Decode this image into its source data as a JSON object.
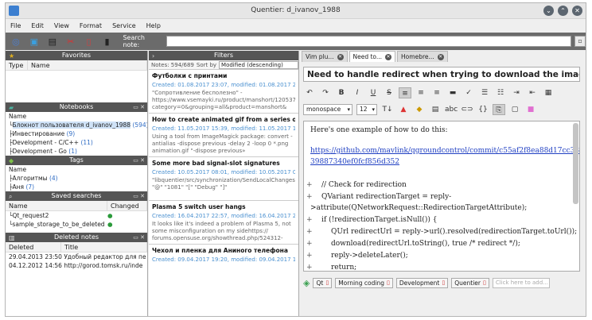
{
  "window": {
    "title": "Quentier: d_ivanov_1988"
  },
  "menu": [
    "File",
    "Edit",
    "View",
    "Format",
    "Service",
    "Help"
  ],
  "toolbar": {
    "search_label": "Search note:"
  },
  "favorites": {
    "title": "Favorites",
    "cols": [
      "Type",
      "Name"
    ]
  },
  "notebooks": {
    "title": "Notebooks",
    "col": "Name",
    "items": [
      {
        "label": "Блокнот пользователя d_ivanov_1988",
        "count": "(594)"
      },
      {
        "label": "Инвестирование",
        "count": "(9)"
      },
      {
        "label": "Development - C/C++",
        "count": "(11)"
      },
      {
        "label": "Development - Go",
        "count": "(1)"
      }
    ]
  },
  "tags": {
    "title": "Tags",
    "col": "Name",
    "items": [
      {
        "label": "Алгоритмы",
        "count": "(4)"
      },
      {
        "label": "Аня",
        "count": "(7)"
      }
    ]
  },
  "saved_searches": {
    "title": "Saved searches",
    "cols": [
      "Name",
      "Changed"
    ],
    "items": [
      "Qt_request2",
      "sample_storage_to_be_deleted"
    ]
  },
  "deleted_notes": {
    "title": "Deleted notes",
    "cols": [
      "Deleted",
      "Title"
    ],
    "items": [
      {
        "date": "29.04.2013 23:50",
        "title": "Удобный редактор для пе"
      },
      {
        "date": "04.12.2012 14:56",
        "title": "http://gorod.tomsk.ru/inde"
      }
    ]
  },
  "filters": {
    "title": "Filters"
  },
  "notes_list": {
    "count_label": "Notes: 594/689",
    "sort_label": "Sort by",
    "sort_value": "Modified (descending)",
    "notes": [
      {
        "title": "Футболки с принтами",
        "dates": "Created: 01.08.2017 23:07, modified: 01.08.2017 2...",
        "preview": "\"Сопротивление бесполезно\" - https://www.vsemayki.ru/product/manshort/120537/?category=0&grouping=all&product=manshort&"
      },
      {
        "title": "How to create animated gif from a series of...",
        "dates": "Created: 11.05.2017 15:39, modified: 11.05.2017 1...",
        "preview": "Using a tool from ImageMagick package: convert -antialias -dispose previous -delay 2 -loop 0 *.png animation.gif \"-dispose previous»"
      },
      {
        "title": "Some more bad signal-slot signatures",
        "dates": "Created: 10.05.2017 08:01, modified: 10.05.2017 0...",
        "preview": "\"libquentier/src/synchronization/SendLocalChangesManager.cpp\" \"@\" \"1081\" \"[\" \"Debug\" \"]\""
      },
      {
        "title": "Plasma 5 switch user hangs",
        "dates": "Created: 16.04.2017 22:57, modified: 16.04.2017 2...",
        "preview": "It looks like it's indeed a problem of Plasma 5, not some misconfiguration on my sidehttps:// forums.opensuse.org/showthread.php/524312-"
      },
      {
        "title": "Чехол и пленка для Аниного телефона",
        "dates": "Created: 09.04.2017 19:20, modified: 09.04.2017 1...",
        "preview": ""
      }
    ]
  },
  "tabs": [
    {
      "label": "Vim plu..."
    },
    {
      "label": "Need to..."
    },
    {
      "label": "Homebre..."
    }
  ],
  "editor": {
    "title": "Need to handle redirect when trying to download the images from",
    "font_family": "monospace",
    "font_size": "12",
    "lines": [
      "Here's one example of how to do this:",
      "https://github.com/mavlink/qgroundcontrol/commit/c55af2f8ea88d17cc38",
      "39887340ef0fcf856d352",
      "// Check for redirection",
      "QVariant redirectionTarget = reply-",
      ">attribute(QNetworkRequest::RedirectionTargetAttribute);",
      "if (!redirectionTarget.isNull()) {",
      "QUrl redirectUrl = reply->url().resolved(redirectionTarget.toUrl());",
      "download(redirectUrl.toString(), true /* redirect */);",
      "reply->deleteLater();",
      "return;"
    ],
    "markers": [
      "+",
      "+",
      "+",
      "+",
      "+",
      "+",
      "+"
    ]
  },
  "note_tags": [
    "Qt",
    "Morning coding",
    "Development",
    "Quentier"
  ],
  "tag_add_placeholder": "Click here to add..."
}
